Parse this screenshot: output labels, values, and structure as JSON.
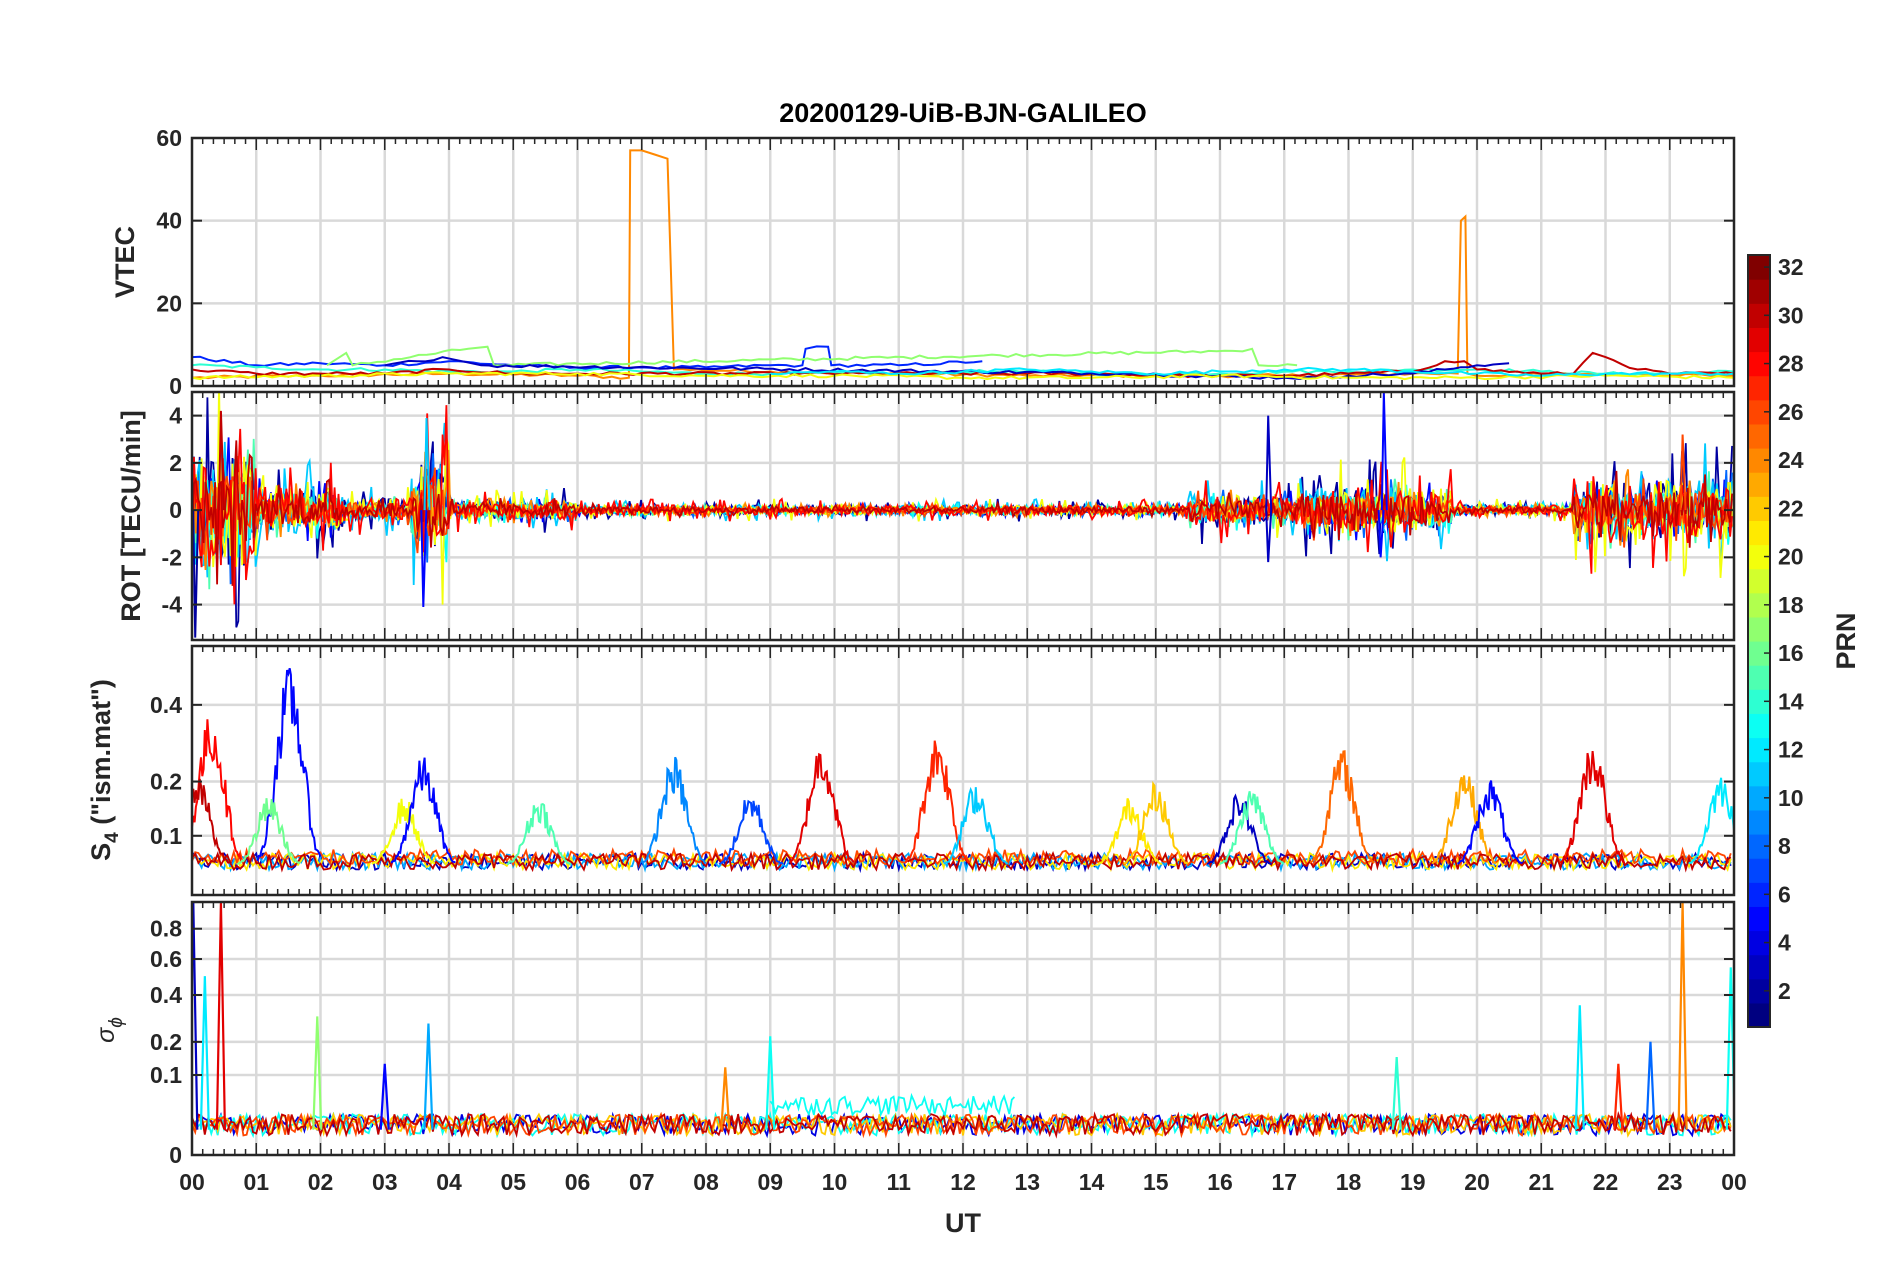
{
  "chart_data": {
    "type": "line",
    "title": "20200129-UiB-BJN-GALILEO",
    "xlabel": "UT",
    "x_tick_labels": [
      "00",
      "01",
      "02",
      "03",
      "04",
      "05",
      "06",
      "07",
      "08",
      "09",
      "10",
      "11",
      "12",
      "13",
      "14",
      "15",
      "16",
      "17",
      "18",
      "19",
      "20",
      "21",
      "22",
      "23",
      "00"
    ],
    "xlim_hours": [
      0,
      24
    ],
    "grid": true,
    "colormap": "jet",
    "colorbar": {
      "label": "PRN",
      "range": [
        1,
        32
      ],
      "tick_labels": [
        "2",
        "4",
        "6",
        "8",
        "10",
        "12",
        "14",
        "16",
        "18",
        "20",
        "22",
        "24",
        "26",
        "28",
        "30",
        "32"
      ],
      "placement": "right"
    },
    "panels": [
      {
        "id": "vtec",
        "ylabel": "VTEC",
        "ylim": [
          0,
          60
        ],
        "yticks": [
          0,
          20,
          40,
          60
        ],
        "ytick_labels": [
          "0",
          "20",
          "40",
          "60"
        ],
        "series": [
          {
            "prn": 24,
            "x": [
              0,
              2,
              4,
              6,
              6.8,
              6.82,
              7,
              7.2,
              7.4,
              7.5,
              9,
              11,
              13,
              15,
              17,
              19,
              19.7,
              19.75,
              19.82,
              19.85,
              20,
              22,
              24
            ],
            "y": [
              2,
              2.5,
              3,
              2.5,
              2,
              57,
              57,
              56,
              55,
              4,
              3.5,
              3,
              2.5,
              2.5,
              2.5,
              3,
              3,
              40,
              41,
              3,
              2.5,
              3,
              2.5
            ]
          },
          {
            "prn": 6,
            "x": [
              0,
              1,
              2,
              3,
              4,
              5,
              6,
              7,
              8,
              9,
              9.5,
              9.55,
              9.9,
              9.95,
              11,
              12.3
            ],
            "y": [
              7,
              5,
              5.5,
              5,
              6,
              5,
              4.5,
              4.5,
              4.5,
              5,
              5,
              9,
              9.5,
              5,
              5,
              6
            ]
          },
          {
            "prn": 14,
            "x": [
              0,
              1,
              2,
              3,
              4,
              5,
              6,
              7,
              8,
              9,
              10,
              11,
              12,
              13,
              14,
              15,
              16,
              17,
              18,
              19,
              20,
              21,
              22,
              23,
              24
            ],
            "y": [
              5,
              4.5,
              4,
              4,
              3.5,
              3.5,
              4,
              3.5,
              3,
              3,
              3,
              3,
              3.5,
              3.5,
              3,
              3,
              3,
              3.5,
              3.5,
              4,
              4,
              3.5,
              3,
              3,
              3.5
            ]
          },
          {
            "prn": 17,
            "x": [
              2.1,
              2.4,
              2.5,
              4.3,
              4.6,
              4.7,
              16.2,
              16.5,
              16.6,
              17.2
            ],
            "y": [
              5,
              8,
              5,
              9,
              9.5,
              5,
              8.5,
              9,
              5,
              5
            ]
          },
          {
            "prn": 30,
            "x": [
              0,
              1,
              2,
              3,
              4,
              5,
              6,
              13,
              14,
              15,
              16,
              17,
              18,
              19,
              19.5,
              19.8,
              20,
              21,
              21.5,
              21.8,
              22,
              22.5,
              23,
              24
            ],
            "y": [
              4,
              3,
              3,
              3,
              4,
              3,
              3,
              3,
              3,
              2.5,
              2.5,
              2.5,
              3,
              3.5,
              6,
              6,
              4,
              3,
              3,
              8,
              7,
              4,
              3,
              3
            ]
          },
          {
            "prn": 3,
            "x": [
              3,
              3.5,
              3.9,
              4.2,
              4.5,
              14.6,
              14.7,
              15.5,
              17,
              17.5,
              18,
              19,
              19.5,
              20,
              20.5
            ],
            "y": [
              5,
              6,
              7,
              6,
              5,
              3,
              3,
              2.5,
              2,
              2,
              2.5,
              3,
              4,
              5,
              5.5
            ]
          },
          {
            "prn": 20,
            "x": [
              0,
              2,
              4,
              6,
              8,
              10,
              12,
              14,
              16,
              18,
              20,
              22,
              24
            ],
            "y": [
              2,
              2.5,
              3,
              3,
              2.5,
              2.5,
              2,
              2,
              2.5,
              2,
              2,
              2.5,
              2
            ]
          },
          {
            "prn": 12,
            "x": [
              9,
              10,
              11,
              12,
              13,
              14,
              15,
              16,
              17,
              18,
              19,
              20,
              21,
              22,
              23,
              24
            ],
            "y": [
              3,
              3.5,
              3,
              3.5,
              4,
              3.5,
              3,
              3.5,
              4,
              4,
              3.5,
              3,
              2.5,
              3,
              3,
              3
            ]
          }
        ]
      },
      {
        "id": "rot",
        "ylabel": "ROT [TECU/min]",
        "ylim": [
          -5.5,
          5
        ],
        "yticks": [
          -4,
          -2,
          0,
          2,
          4
        ],
        "ytick_labels": [
          "-4",
          "-2",
          "0",
          "2",
          "4"
        ],
        "noise_bands": [
          {
            "t_start": 0,
            "t_end": 1.0,
            "amplitude": 3.5
          },
          {
            "t_start": 1.0,
            "t_end": 2.3,
            "amplitude": 1.4
          },
          {
            "t_start": 2.3,
            "t_end": 3.4,
            "amplitude": 0.7
          },
          {
            "t_start": 3.4,
            "t_end": 4.0,
            "amplitude": 2.8
          },
          {
            "t_start": 4.0,
            "t_end": 6.0,
            "amplitude": 0.6
          },
          {
            "t_start": 6.0,
            "t_end": 15.5,
            "amplitude": 0.3
          },
          {
            "t_start": 15.5,
            "t_end": 17.3,
            "amplitude": 0.9
          },
          {
            "t_start": 17.3,
            "t_end": 19.6,
            "amplitude": 1.4
          },
          {
            "t_start": 19.6,
            "t_end": 21.5,
            "amplitude": 0.3
          },
          {
            "t_start": 21.5,
            "t_end": 24.0,
            "amplitude": 1.8
          }
        ],
        "spikes": [
          {
            "t": 0.45,
            "value": 4.2,
            "prn": 30
          },
          {
            "t": 3.65,
            "value": 3.9,
            "prn": 11
          },
          {
            "t": 3.6,
            "value": -4.1,
            "prn": 5
          },
          {
            "t": 16.75,
            "value": 4.0,
            "prn": 3
          },
          {
            "t": 16.75,
            "value": -2.2,
            "prn": 3
          },
          {
            "t": 18.55,
            "value": 5.0,
            "prn": 5
          },
          {
            "t": 18.5,
            "value": -2.0,
            "prn": 5
          },
          {
            "t": 23.2,
            "value": 3.2,
            "prn": 26
          },
          {
            "t": 0.05,
            "value": -5.4,
            "prn": 2
          }
        ]
      },
      {
        "id": "s4",
        "ylabel": "S4 (\"ism.mat\")",
        "ylabel_main": "S",
        "ylabel_sub": "4",
        "ylabel_rest": " (\"ism.mat\")",
        "ylim": [
          0.03,
          0.6
        ],
        "yscale": "sqrt",
        "yticks": [
          0.1,
          0.2,
          0.4
        ],
        "ytick_labels": [
          "0.1",
          "0.2",
          "0.4"
        ],
        "baseline": 0.055,
        "bursts": [
          {
            "t": 0.3,
            "peak": 0.38,
            "prn": 28
          },
          {
            "t": 0.1,
            "peak": 0.21,
            "prn": 30
          },
          {
            "t": 1.52,
            "peak": 0.53,
            "prn": 5
          },
          {
            "t": 1.2,
            "peak": 0.17,
            "prn": 16
          },
          {
            "t": 3.3,
            "peak": 0.17,
            "prn": 20
          },
          {
            "t": 3.6,
            "peak": 0.26,
            "prn": 5
          },
          {
            "t": 5.4,
            "peak": 0.17,
            "prn": 15
          },
          {
            "t": 7.5,
            "peak": 0.26,
            "prn": 9
          },
          {
            "t": 8.7,
            "peak": 0.18,
            "prn": 7
          },
          {
            "t": 9.8,
            "peak": 0.3,
            "prn": 29
          },
          {
            "t": 11.6,
            "peak": 0.32,
            "prn": 27
          },
          {
            "t": 12.2,
            "peak": 0.2,
            "prn": 11
          },
          {
            "t": 14.6,
            "peak": 0.17,
            "prn": 21
          },
          {
            "t": 15.0,
            "peak": 0.2,
            "prn": 22
          },
          {
            "t": 16.3,
            "peak": 0.18,
            "prn": 3
          },
          {
            "t": 16.5,
            "peak": 0.19,
            "prn": 15
          },
          {
            "t": 17.9,
            "peak": 0.28,
            "prn": 25
          },
          {
            "t": 19.8,
            "peak": 0.24,
            "prn": 23
          },
          {
            "t": 20.2,
            "peak": 0.21,
            "prn": 5
          },
          {
            "t": 21.8,
            "peak": 0.3,
            "prn": 29
          },
          {
            "t": 23.8,
            "peak": 0.22,
            "prn": 12
          }
        ]
      },
      {
        "id": "sigma_phi",
        "ylabel": "σϕ",
        "ylabel_main": "σ",
        "ylabel_sub": "ϕ",
        "ylim": [
          0,
          1
        ],
        "yscale": "sqrt",
        "yticks": [
          0,
          0.1,
          0.2,
          0.4,
          0.6,
          0.8
        ],
        "ytick_labels": [
          "0",
          "0.1",
          "0.2",
          "0.4",
          "0.6",
          "0.8"
        ],
        "baseline": 0.02,
        "spikes": [
          {
            "t": 0.02,
            "value": 1.0,
            "prn": 3
          },
          {
            "t": 0.2,
            "value": 0.5,
            "prn": 12
          },
          {
            "t": 0.45,
            "value": 1.0,
            "prn": 29
          },
          {
            "t": 1.95,
            "value": 0.3,
            "prn": 17
          },
          {
            "t": 3.68,
            "value": 0.27,
            "prn": 10
          },
          {
            "t": 3.0,
            "value": 0.13,
            "prn": 5
          },
          {
            "t": 8.3,
            "value": 0.12,
            "prn": 24
          },
          {
            "t": 9.0,
            "value": 0.22,
            "prn": 13
          },
          {
            "t": 18.75,
            "value": 0.15,
            "prn": 14
          },
          {
            "t": 21.6,
            "value": 0.35,
            "prn": 12
          },
          {
            "t": 22.2,
            "value": 0.13,
            "prn": 27
          },
          {
            "t": 22.7,
            "value": 0.2,
            "prn": 8
          },
          {
            "t": 23.2,
            "value": 1.0,
            "prn": 24
          },
          {
            "t": 23.95,
            "value": 0.55,
            "prn": 13
          }
        ],
        "plateaus": [
          {
            "t_start": 9.0,
            "t_end": 12.8,
            "level": 0.05,
            "prn": 13
          }
        ]
      }
    ]
  }
}
